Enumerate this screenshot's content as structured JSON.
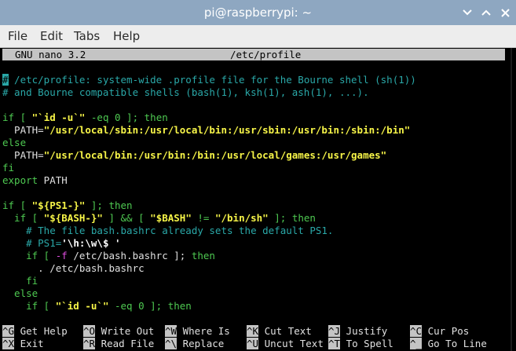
{
  "window": {
    "title": "pi@raspberrypi: ~",
    "controls": [
      "minimize",
      "maximize",
      "close"
    ]
  },
  "menu": [
    "File",
    "Edit",
    "Tabs",
    "Help"
  ],
  "nano": {
    "version": "GNU nano 3.2",
    "filename": "/etc/profile",
    "overflow_marker": "$"
  },
  "editor": {
    "lines": [
      [
        {
          "t": "#",
          "s": "cursor"
        },
        {
          "t": " /etc/profile: system-wide .profile file for the Bourne shell (sh(1))",
          "s": "c"
        }
      ],
      [
        {
          "t": "# and Bourne compatible shells (bash(1), ksh(1), ash(1), ...).",
          "s": "c"
        }
      ],
      [],
      [
        {
          "t": "if",
          "s": "g"
        },
        {
          "t": " [ ",
          "s": "g"
        },
        {
          "t": "\"`id -u`\"",
          "s": "y"
        },
        {
          "t": " -eq 0 ]; ",
          "s": "g"
        },
        {
          "t": "then",
          "s": "g"
        }
      ],
      [
        {
          "t": "  PATH=",
          "s": "w"
        },
        {
          "t": "\"/usr/local/sbin:/usr/local/bin:/usr/sbin:/usr/bin:/sbin:/bin\"",
          "s": "y"
        }
      ],
      [
        {
          "t": "else",
          "s": "g"
        }
      ],
      [
        {
          "t": "  PATH=",
          "s": "w"
        },
        {
          "t": "\"/usr/local/bin:/usr/bin:/bin:/usr/local/games:/usr/games\"",
          "s": "y"
        }
      ],
      [
        {
          "t": "fi",
          "s": "g"
        }
      ],
      [
        {
          "t": "export",
          "s": "g"
        },
        {
          "t": " PATH",
          "s": "w"
        }
      ],
      [],
      [
        {
          "t": "if",
          "s": "g"
        },
        {
          "t": " [ ",
          "s": "g"
        },
        {
          "t": "\"${PS1-}\"",
          "s": "y"
        },
        {
          "t": " ]; ",
          "s": "g"
        },
        {
          "t": "then",
          "s": "g"
        }
      ],
      [
        {
          "t": "  if",
          "s": "g"
        },
        {
          "t": " [ ",
          "s": "g"
        },
        {
          "t": "\"${BASH-}\"",
          "s": "y"
        },
        {
          "t": " ] && [ ",
          "s": "g"
        },
        {
          "t": "\"$BASH\"",
          "s": "y"
        },
        {
          "t": " != ",
          "s": "g"
        },
        {
          "t": "\"/bin/sh\"",
          "s": "y"
        },
        {
          "t": " ]; ",
          "s": "g"
        },
        {
          "t": "then",
          "s": "g"
        }
      ],
      [
        {
          "t": "    # The file bash.bashrc already sets the default PS1.",
          "s": "c"
        }
      ],
      [
        {
          "t": "    # PS1=",
          "s": "c"
        },
        {
          "t": "'\\h:\\w\\$ '",
          "s": "bw"
        }
      ],
      [
        {
          "t": "    if",
          "s": "g"
        },
        {
          "t": " [ ",
          "s": "g"
        },
        {
          "t": "-f",
          "s": "m"
        },
        {
          "t": " /etc/bash.bashrc ]; ",
          "s": "w"
        },
        {
          "t": "then",
          "s": "g"
        }
      ],
      [
        {
          "t": "      . /etc/bash.bashrc",
          "s": "w"
        }
      ],
      [
        {
          "t": "    fi",
          "s": "g"
        }
      ],
      [
        {
          "t": "  else",
          "s": "g"
        }
      ],
      [
        {
          "t": "    if",
          "s": "g"
        },
        {
          "t": " [ ",
          "s": "g"
        },
        {
          "t": "\"`id -u`\"",
          "s": "y"
        },
        {
          "t": " -eq 0 ]; ",
          "s": "g"
        },
        {
          "t": "then",
          "s": "g"
        }
      ]
    ]
  },
  "shortcuts": [
    [
      {
        "key": "^G",
        "label": "Get Help"
      },
      {
        "key": "^O",
        "label": "Write Out"
      },
      {
        "key": "^W",
        "label": "Where Is"
      },
      {
        "key": "^K",
        "label": "Cut Text"
      },
      {
        "key": "^J",
        "label": "Justify"
      },
      {
        "key": "^C",
        "label": "Cur Pos"
      }
    ],
    [
      {
        "key": "^X",
        "label": "Exit"
      },
      {
        "key": "^R",
        "label": "Read File"
      },
      {
        "key": "^\\",
        "label": "Replace"
      },
      {
        "key": "^U",
        "label": "Uncut Text"
      },
      {
        "key": "^T",
        "label": "To Spell"
      },
      {
        "key": "^_",
        "label": "Go To Line"
      }
    ]
  ]
}
